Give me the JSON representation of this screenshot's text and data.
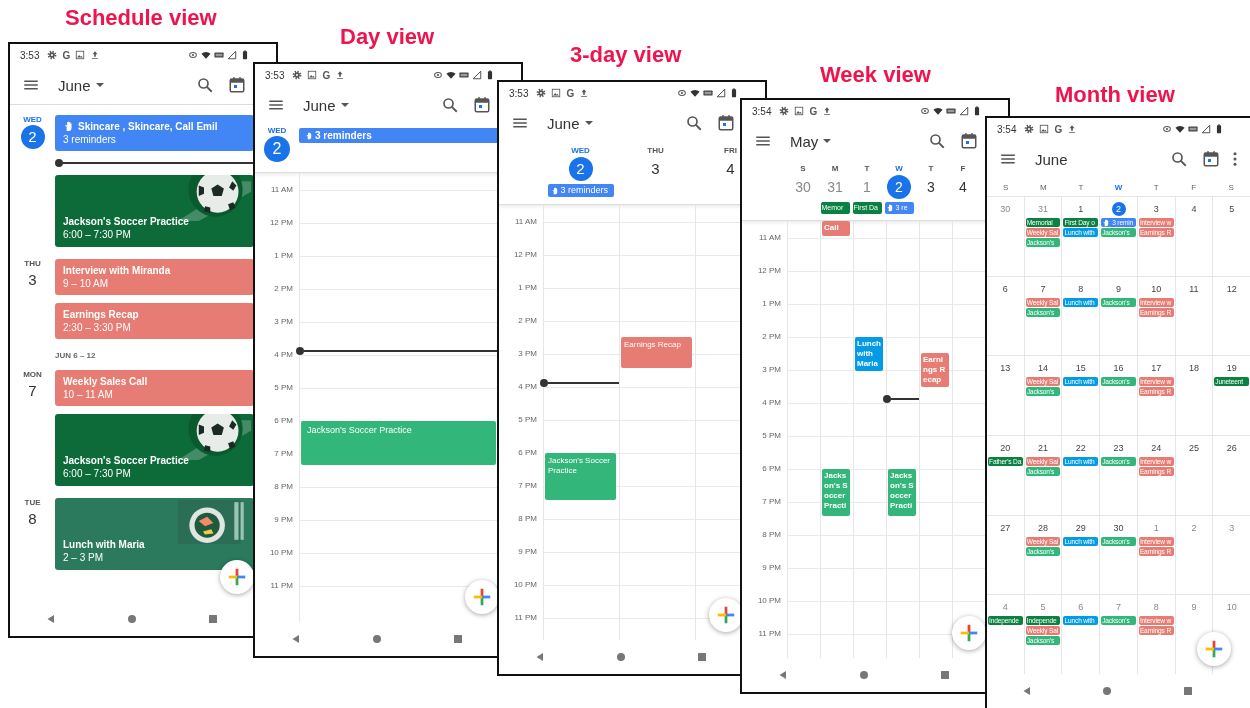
{
  "phones": [
    {
      "kind": "schedule",
      "caption": "Schedule view",
      "status": {
        "time": "3:53",
        "icons": [
          {
            "kind": "gear"
          },
          {
            "kind": "letter",
            "text": "G"
          },
          {
            "kind": "image"
          },
          {
            "kind": "upload"
          }
        ]
      },
      "appbar": {
        "title": "June",
        "dropdown": true,
        "more": false
      },
      "agenda": [
        {
          "kind": "day",
          "dow": "WED",
          "date": "2",
          "today": true,
          "items": [
            {
              "kind": "reminder",
              "title": "Skincare , Skincare, Call Emil",
              "detail": "3 reminders",
              "color": "#4285f4"
            },
            {
              "kind": "now"
            },
            {
              "kind": "soccer",
              "title": "Jackson's Soccer Practice",
              "detail": "6:00 – 7:30 PM"
            }
          ]
        },
        {
          "kind": "day",
          "dow": "THU",
          "date": "3",
          "today": false,
          "items": [
            {
              "kind": "event",
              "title": "Interview with Miranda",
              "detail": "9 – 10 AM",
              "color": "#e67c73"
            },
            {
              "kind": "event",
              "title": "Earnings Recap",
              "detail": "2:30 – 3:30 PM",
              "color": "#e67c73"
            }
          ]
        },
        {
          "kind": "range",
          "label": "JUN 6 – 12"
        },
        {
          "kind": "day",
          "dow": "MON",
          "date": "7",
          "today": false,
          "items": [
            {
              "kind": "event",
              "title": "Weekly Sales Call",
              "detail": "10 – 11 AM",
              "color": "#e67c73"
            },
            {
              "kind": "soccer",
              "title": "Jackson's Soccer Practice",
              "detail": "6:00 – 7:30 PM"
            }
          ]
        },
        {
          "kind": "day",
          "dow": "TUE",
          "date": "8",
          "today": false,
          "items": [
            {
              "kind": "lunch",
              "title": "Lunch with Maria",
              "detail": "2 – 3 PM"
            }
          ]
        }
      ]
    },
    {
      "kind": "day",
      "caption": "Day view",
      "status": {
        "time": "3:53",
        "icons": [
          {
            "kind": "gear"
          },
          {
            "kind": "image"
          },
          {
            "kind": "letter",
            "text": "G"
          },
          {
            "kind": "upload"
          }
        ]
      },
      "appbar": {
        "title": "June",
        "dropdown": true,
        "more": false
      },
      "grid": {
        "hours": [
          "11 AM",
          "12 PM",
          "1 PM",
          "2 PM",
          "3 PM",
          "4 PM",
          "5 PM",
          "6 PM",
          "7 PM",
          "8 PM",
          "9 PM",
          "10 PM",
          "11 PM"
        ],
        "columns": [
          {
            "dow": "WED",
            "date": "2",
            "today": true,
            "all_day": [
              {
                "kind": "reminder",
                "title": "3 reminders",
                "color": "#4285f4"
              }
            ],
            "events": [
              {
                "title": "Jackson's Soccer Practice",
                "color": "#33b679"
              }
            ]
          }
        ]
      }
    },
    {
      "kind": "three_day",
      "caption": "3-day view",
      "status": {
        "time": "3:53",
        "icons": [
          {
            "kind": "gear"
          },
          {
            "kind": "image"
          },
          {
            "kind": "letter",
            "text": "G"
          },
          {
            "kind": "upload"
          }
        ]
      },
      "appbar": {
        "title": "June",
        "dropdown": true,
        "more": false
      },
      "grid": {
        "hours": [
          "11 AM",
          "12 PM",
          "1 PM",
          "2 PM",
          "3 PM",
          "4 PM",
          "5 PM",
          "6 PM",
          "7 PM",
          "8 PM",
          "9 PM",
          "10 PM",
          "11 PM"
        ],
        "columns": [
          {
            "dow": "WED",
            "date": "2",
            "today": true,
            "all_day": [
              {
                "kind": "reminder",
                "title": "3 reminders",
                "color": "#4285f4"
              }
            ],
            "events": [
              {
                "title": "Jackson's Soccer Practice",
                "color": "#33b679"
              }
            ]
          },
          {
            "dow": "THU",
            "date": "3",
            "today": false,
            "events": [
              {
                "title": "Earnings Recap",
                "color": "#e67c73"
              }
            ]
          },
          {
            "dow": "FRI",
            "date": "4",
            "today": false
          }
        ]
      }
    },
    {
      "kind": "week",
      "caption": "Week view",
      "status": {
        "time": "3:54",
        "icons": [
          {
            "kind": "gear"
          },
          {
            "kind": "image"
          },
          {
            "kind": "letter",
            "text": "G"
          },
          {
            "kind": "upload"
          }
        ]
      },
      "appbar": {
        "title": "May",
        "dropdown": true,
        "more": false
      },
      "grid": {
        "hours": [
          "11 AM",
          "12 PM",
          "1 PM",
          "2 PM",
          "3 PM",
          "4 PM",
          "5 PM",
          "6 PM",
          "7 PM",
          "8 PM",
          "9 PM",
          "10 PM",
          "11 PM"
        ],
        "columns": [
          {
            "dow": "S",
            "date": "30",
            "today": false,
            "past": true
          },
          {
            "dow": "M",
            "date": "31",
            "today": false,
            "past": true,
            "all_day": [
              {
                "kind": "event",
                "title": "Memor",
                "color": "#0b8043"
              }
            ],
            "events": [
              {
                "title": "Call",
                "color": "#e67c73"
              },
              {
                "title": "Jackson's Soccer Practi",
                "color": "#33b679"
              }
            ]
          },
          {
            "dow": "T",
            "date": "1",
            "today": false,
            "past": true,
            "all_day": [
              {
                "kind": "event",
                "title": "First Da",
                "color": "#0b8043"
              }
            ],
            "events": [
              {
                "title": "Lunch with Maria",
                "color": "#039be5"
              }
            ]
          },
          {
            "dow": "W",
            "date": "2",
            "today": true,
            "past": false,
            "all_day": [
              {
                "kind": "reminder",
                "title": "3 re",
                "color": "#4285f4"
              }
            ],
            "events": [
              {
                "title": "Jackson's Soccer Practi",
                "color": "#33b679"
              }
            ]
          },
          {
            "dow": "T",
            "date": "3",
            "today": false,
            "past": false,
            "events": [
              {
                "title": "Earnings Recap",
                "color": "#e67c73"
              }
            ]
          },
          {
            "dow": "F",
            "date": "4",
            "today": false,
            "past": false
          }
        ]
      }
    },
    {
      "kind": "month",
      "caption": "Month view",
      "status": {
        "time": "3:54",
        "icons": [
          {
            "kind": "gear"
          },
          {
            "kind": "image"
          },
          {
            "kind": "letter",
            "text": "G"
          },
          {
            "kind": "upload"
          }
        ]
      },
      "appbar": {
        "title": "June",
        "dropdown": false,
        "more": true
      },
      "month": {
        "weekdays": [
          {
            "label": "S",
            "today": false
          },
          {
            "label": "M",
            "today": false
          },
          {
            "label": "T",
            "today": false
          },
          {
            "label": "W",
            "today": true
          },
          {
            "label": "T",
            "today": false
          },
          {
            "label": "F",
            "today": false
          },
          {
            "label": "S",
            "today": false
          }
        ],
        "weeks": [
          [
            {
              "date": "30",
              "other_month": true,
              "today": false
            },
            {
              "date": "31",
              "other_month": true,
              "today": false,
              "chips": [
                {
                  "kind": "event",
                  "title": "Memorial",
                  "color": "#0b8043"
                },
                {
                  "kind": "event",
                  "title": "Weekly Sal",
                  "color": "#e67c73"
                },
                {
                  "kind": "event",
                  "title": "Jackson's",
                  "color": "#33b679"
                }
              ]
            },
            {
              "date": "1",
              "other_month": false,
              "today": false,
              "chips": [
                {
                  "kind": "event",
                  "title": "First Day o",
                  "color": "#0b8043"
                },
                {
                  "kind": "event",
                  "title": "Lunch with",
                  "color": "#039be5"
                }
              ]
            },
            {
              "date": "2",
              "other_month": false,
              "today": true,
              "chips": [
                {
                  "kind": "reminder",
                  "title": "3 remin",
                  "color": "#4285f4"
                },
                {
                  "kind": "event",
                  "title": "Jackson's",
                  "color": "#33b679"
                }
              ]
            },
            {
              "date": "3",
              "other_month": false,
              "today": false,
              "chips": [
                {
                  "kind": "event",
                  "title": "Interview w",
                  "color": "#e67c73"
                },
                {
                  "kind": "event",
                  "title": "Earnings R",
                  "color": "#e67c73"
                }
              ]
            },
            {
              "date": "4",
              "other_month": false,
              "today": false
            },
            {
              "date": "5",
              "other_month": false,
              "today": false
            }
          ],
          [
            {
              "date": "6",
              "other_month": false,
              "today": false
            },
            {
              "date": "7",
              "other_month": false,
              "today": false,
              "chips": [
                {
                  "kind": "event",
                  "title": "Weekly Sal",
                  "color": "#e67c73"
                },
                {
                  "kind": "event",
                  "title": "Jackson's",
                  "color": "#33b679"
                }
              ]
            },
            {
              "date": "8",
              "other_month": false,
              "today": false,
              "chips": [
                {
                  "kind": "event",
                  "title": "Lunch with",
                  "color": "#039be5"
                }
              ]
            },
            {
              "date": "9",
              "other_month": false,
              "today": false,
              "chips": [
                {
                  "kind": "event",
                  "title": "Jackson's",
                  "color": "#33b679"
                }
              ]
            },
            {
              "date": "10",
              "other_month": false,
              "today": false,
              "chips": [
                {
                  "kind": "event",
                  "title": "Interview w",
                  "color": "#e67c73"
                },
                {
                  "kind": "event",
                  "title": "Earnings R",
                  "color": "#e67c73"
                }
              ]
            },
            {
              "date": "11",
              "other_month": false,
              "today": false
            },
            {
              "date": "12",
              "other_month": false,
              "today": false
            }
          ],
          [
            {
              "date": "13",
              "other_month": false,
              "today": false
            },
            {
              "date": "14",
              "other_month": false,
              "today": false,
              "chips": [
                {
                  "kind": "event",
                  "title": "Weekly Sal",
                  "color": "#e67c73"
                },
                {
                  "kind": "event",
                  "title": "Jackson's",
                  "color": "#33b679"
                }
              ]
            },
            {
              "date": "15",
              "other_month": false,
              "today": false,
              "chips": [
                {
                  "kind": "event",
                  "title": "Lunch with",
                  "color": "#039be5"
                }
              ]
            },
            {
              "date": "16",
              "other_month": false,
              "today": false,
              "chips": [
                {
                  "kind": "event",
                  "title": "Jackson's",
                  "color": "#33b679"
                }
              ]
            },
            {
              "date": "17",
              "other_month": false,
              "today": false,
              "chips": [
                {
                  "kind": "event",
                  "title": "Interview w",
                  "color": "#e67c73"
                },
                {
                  "kind": "event",
                  "title": "Earnings R",
                  "color": "#e67c73"
                }
              ]
            },
            {
              "date": "18",
              "other_month": false,
              "today": false
            },
            {
              "date": "19",
              "other_month": false,
              "today": false,
              "chips": [
                {
                  "kind": "event",
                  "title": "Juneteent",
                  "color": "#0b8043"
                }
              ]
            }
          ],
          [
            {
              "date": "20",
              "other_month": false,
              "today": false,
              "chips": [
                {
                  "kind": "event",
                  "title": "Father's Da",
                  "color": "#0b8043"
                }
              ]
            },
            {
              "date": "21",
              "other_month": false,
              "today": false,
              "chips": [
                {
                  "kind": "event",
                  "title": "Weekly Sal",
                  "color": "#e67c73"
                },
                {
                  "kind": "event",
                  "title": "Jackson's",
                  "color": "#33b679"
                }
              ]
            },
            {
              "date": "22",
              "other_month": false,
              "today": false,
              "chips": [
                {
                  "kind": "event",
                  "title": "Lunch with",
                  "color": "#039be5"
                }
              ]
            },
            {
              "date": "23",
              "other_month": false,
              "today": false,
              "chips": [
                {
                  "kind": "event",
                  "title": "Jackson's",
                  "color": "#33b679"
                }
              ]
            },
            {
              "date": "24",
              "other_month": false,
              "today": false,
              "chips": [
                {
                  "kind": "event",
                  "title": "Interview w",
                  "color": "#e67c73"
                },
                {
                  "kind": "event",
                  "title": "Earnings R",
                  "color": "#e67c73"
                }
              ]
            },
            {
              "date": "25",
              "other_month": false,
              "today": false
            },
            {
              "date": "26",
              "other_month": false,
              "today": false
            }
          ],
          [
            {
              "date": "27",
              "other_month": false,
              "today": false
            },
            {
              "date": "28",
              "other_month": false,
              "today": false,
              "chips": [
                {
                  "kind": "event",
                  "title": "Weekly Sal",
                  "color": "#e67c73"
                },
                {
                  "kind": "event",
                  "title": "Jackson's",
                  "color": "#33b679"
                }
              ]
            },
            {
              "date": "29",
              "other_month": false,
              "today": false,
              "chips": [
                {
                  "kind": "event",
                  "title": "Lunch with",
                  "color": "#039be5"
                }
              ]
            },
            {
              "date": "30",
              "other_month": false,
              "today": false,
              "chips": [
                {
                  "kind": "event",
                  "title": "Jackson's",
                  "color": "#33b679"
                }
              ]
            },
            {
              "date": "1",
              "other_month": true,
              "today": false,
              "chips": [
                {
                  "kind": "event",
                  "title": "Interview w",
                  "color": "#e67c73"
                },
                {
                  "kind": "event",
                  "title": "Earnings R",
                  "color": "#e67c73"
                }
              ]
            },
            {
              "date": "2",
              "other_month": true,
              "today": false
            },
            {
              "date": "3",
              "other_month": true,
              "today": false
            }
          ],
          [
            {
              "date": "4",
              "other_month": true,
              "today": false,
              "chips": [
                {
                  "kind": "event",
                  "title": "Independe",
                  "color": "#0b8043"
                }
              ]
            },
            {
              "date": "5",
              "other_month": true,
              "today": false,
              "chips": [
                {
                  "kind": "event",
                  "title": "Independe",
                  "color": "#0b8043"
                },
                {
                  "kind": "event",
                  "title": "Weekly Sal",
                  "color": "#e67c73"
                },
                {
                  "kind": "event",
                  "title": "Jackson's",
                  "color": "#33b679"
                }
              ]
            },
            {
              "date": "6",
              "other_month": true,
              "today": false,
              "chips": [
                {
                  "kind": "event",
                  "title": "Lunch with",
                  "color": "#039be5"
                }
              ]
            },
            {
              "date": "7",
              "other_month": true,
              "today": false,
              "chips": [
                {
                  "kind": "event",
                  "title": "Jackson's",
                  "color": "#33b679"
                }
              ]
            },
            {
              "date": "8",
              "other_month": true,
              "today": false,
              "chips": [
                {
                  "kind": "event",
                  "title": "Interview w",
                  "color": "#e67c73"
                },
                {
                  "kind": "event",
                  "title": "Earnings R",
                  "color": "#e67c73"
                }
              ]
            },
            {
              "date": "9",
              "other_month": true,
              "today": false
            },
            {
              "date": "10",
              "other_month": true,
              "today": false
            }
          ]
        ]
      }
    }
  ]
}
